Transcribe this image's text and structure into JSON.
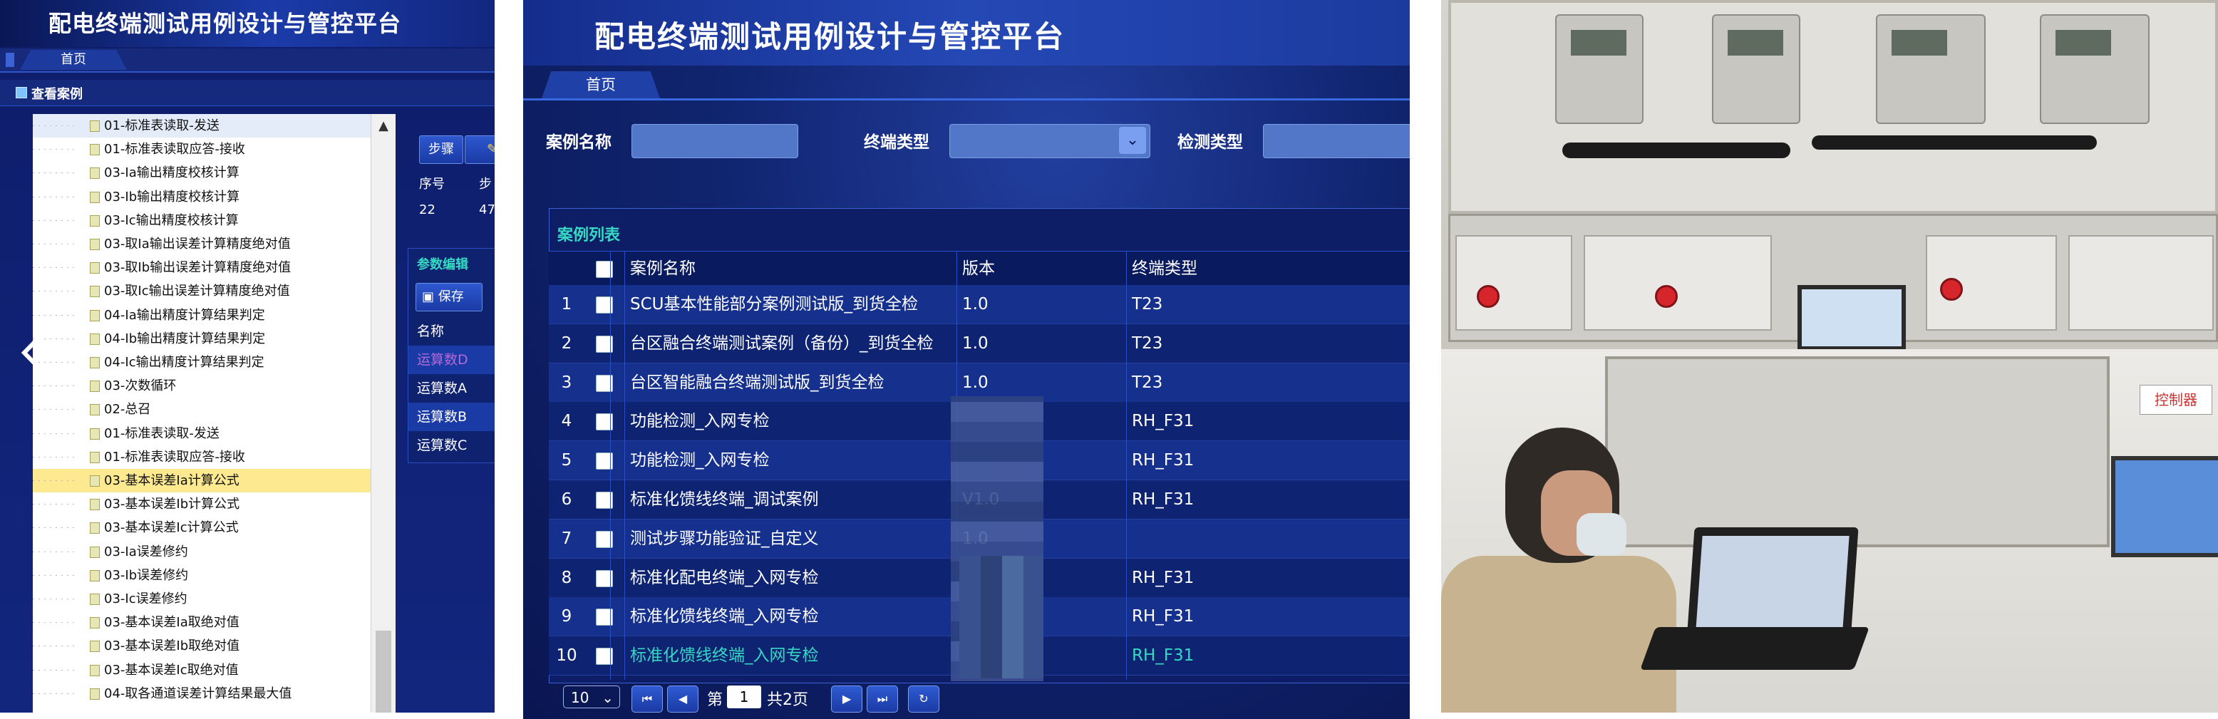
{
  "panel_left": {
    "title": "配电终端测试用例设计与管控平台",
    "tab_home": "首页",
    "section_title": "查看案例",
    "tree_items": [
      "01-标准表读取-发送",
      "01-标准表读取应答-接收",
      "03-Ia输出精度校核计算",
      "03-Ib输出精度校核计算",
      "03-Ic输出精度校核计算",
      "03-取Ia输出误差计算精度绝对值",
      "03-取Ib输出误差计算精度绝对值",
      "03-取Ic输出误差计算精度绝对值",
      "04-Ia输出精度计算结果判定",
      "04-Ib输出精度计算结果判定",
      "04-Ic输出精度计算结果判定",
      "03-次数循环",
      "02-总召",
      "01-标准表读取-发送",
      "01-标准表读取应答-接收",
      "03-基本误差Ia计算公式",
      "03-基本误差Ib计算公式",
      "03-基本误差Ic计算公式",
      "03-Ia误差修约",
      "03-Ib误差修约",
      "03-Ic误差修约",
      "03-基本误差Ia取绝对值",
      "03-基本误差Ib取绝对值",
      "03-基本误差Ic取绝对值",
      "04-取各通道误差计算结果最大值"
    ],
    "selected_index": 15,
    "buttons": {
      "step": "步骤",
      "edit": "修"
    },
    "steps_table": {
      "headers": [
        "序号",
        "步"
      ],
      "row": [
        "22",
        "47"
      ]
    },
    "param_title": "参数编辑",
    "save_label": "保存",
    "param_header": "名称",
    "params": [
      "运算数D",
      "运算数A",
      "运算数B",
      "运算数C"
    ],
    "scroll_up_glyph": "▲",
    "nav_arrow": "chevron-left-icon"
  },
  "panel_mid": {
    "title": "配电终端测试用例设计与管控平台",
    "tab_home": "首页",
    "filters": {
      "case_name": "案例名称",
      "terminal_type": "终端类型",
      "test_type": "检测类型"
    },
    "dropdown_glyph": "⌄",
    "list_title": "案例列表",
    "columns": [
      "",
      "案例名称",
      "版本",
      "终端类型"
    ],
    "rows": [
      {
        "no": "1",
        "name": "SCU基本性能部分案例测试版_到货全检",
        "version": "1.0",
        "type": "T23"
      },
      {
        "no": "2",
        "name": "台区融合终端测试案例（备份）_到货全检",
        "version": "1.0",
        "type": "T23"
      },
      {
        "no": "3",
        "name": "台区智能融合终端测试版_到货全检",
        "version": "1.0",
        "type": "T23"
      },
      {
        "no": "4",
        "name": "功能检测_入网专检",
        "version": "",
        "type": "RH_F31"
      },
      {
        "no": "5",
        "name": "功能检测_入网专检",
        "version": "",
        "type": "RH_F31"
      },
      {
        "no": "6",
        "name": "标准化馈线终端_调试案例",
        "version": "V1.0",
        "type": "RH_F31"
      },
      {
        "no": "7",
        "name": "测试步骤功能验证_自定义",
        "version": "1.0",
        "type": ""
      },
      {
        "no": "8",
        "name": "标准化配电终端_入网专检",
        "version": "",
        "type": "RH_F31"
      },
      {
        "no": "9",
        "name": "标准化馈线终端_入网专检",
        "version": "",
        "type": "RH_F31"
      },
      {
        "no": "10",
        "name": "标准化馈线终端_入网专检",
        "version": "",
        "type": "RH_F31"
      }
    ],
    "pager": {
      "page_size": "10",
      "prefix": "第",
      "page": "1",
      "suffix": "共2页"
    },
    "colors": {
      "accent_teal": "#37d8c3",
      "header_blue": "#1f40a6"
    }
  },
  "panel_right": {
    "sign_text": "控制器"
  }
}
